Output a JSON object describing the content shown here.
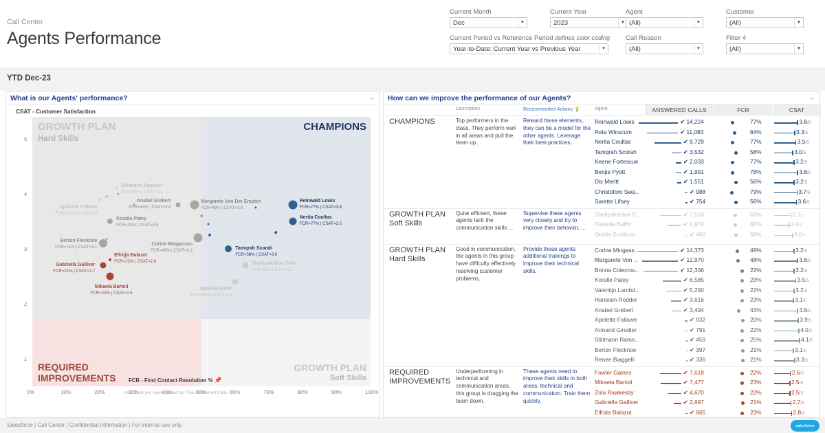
{
  "header": {
    "breadcrumb": "Call Center",
    "title": "Agents Performance"
  },
  "filters": [
    {
      "label": "Current Month",
      "value": "Dec",
      "note": ""
    },
    {
      "label": "Current Year",
      "value": "2023",
      "note": ""
    },
    {
      "label": "Agent",
      "value": "(All)",
      "note": ""
    },
    {
      "label": "Customer",
      "value": "(All)",
      "note": ""
    },
    {
      "label": "Current Period vs Reference Period",
      "value": "Year-to-Date: Current Year vs Previous Year",
      "note": "defines color coding"
    },
    {
      "label": "Call Reason",
      "value": "(All)",
      "note": ""
    },
    {
      "label": "Filter 4",
      "value": "(All)",
      "note": ""
    }
  ],
  "period_bar": {
    "label": "YTD Dec-23"
  },
  "left_panel": {
    "title": "What is our Agents' performance?",
    "arrow": "→"
  },
  "right_panel": {
    "title": "How can we improve the performance of our Agents?",
    "arrow": "→"
  },
  "footer": {
    "text": "Salesforce | Call Center | Confidential Information | For internal use only",
    "logo": "salesforce"
  },
  "chart_data": {
    "type": "scatter",
    "title": "What is our Agents' performance?",
    "xlabel": "FCR - First Contact Resolution %",
    "ylabel": "CSAT - Customer Satisfaction",
    "footnote": "One circle per Agent, sized by Total Answered Calls",
    "xlim": [
      0,
      100
    ],
    "ylim": [
      0.5,
      5.4
    ],
    "xticks": [
      "0%",
      "10%",
      "20%",
      "30%",
      "40%",
      "50%",
      "60%",
      "70%",
      "80%",
      "90%",
      "100%"
    ],
    "yticks": [
      "5",
      "4",
      "3",
      "2",
      "1"
    ],
    "grid": false,
    "quadrants": [
      {
        "key": "tl",
        "title": "GROWTH PLAN",
        "subtitle": "Hard Skills",
        "color": "#e8e8e8"
      },
      {
        "key": "tr",
        "title": "CHAMPIONS",
        "subtitle": "",
        "color": "#e1e6ec"
      },
      {
        "key": "bl",
        "title": "REQUIRED IMPROVEMENTS",
        "subtitle": "",
        "color": "#f7e2e1"
      },
      {
        "key": "br",
        "title": "GROWTH PLAN",
        "subtitle": "Soft Skills",
        "color": "#f5f4f4"
      }
    ],
    "points": [
      {
        "name": "Reinwald Lowis",
        "fcr": 77,
        "csat": 3.8,
        "label": "Reinwald Lowis",
        "sub": "FCR=77% | CSAT=3.8",
        "group": "blue",
        "size": 13
      },
      {
        "name": "Nerita Coultas",
        "fcr": 77,
        "csat": 3.5,
        "label": "Nerita Coultas",
        "sub": "FCR=77% | CSAT=3.5",
        "group": "blue",
        "size": 11
      },
      {
        "name": "Tamqrah Scorah",
        "fcr": 58,
        "csat": 3.0,
        "label": "Tamqrah Scorah",
        "sub": "FCR=58% | CSAT=3.0",
        "group": "blue",
        "size": 10
      },
      {
        "name": "Margarete Von Der Empten",
        "fcr": 48,
        "csat": 3.8,
        "label": "Margarete Von Der Empten",
        "sub": "FCR=48% | CSAT=3.8",
        "group": "gray",
        "size": 13
      },
      {
        "name": "Corine Mingasson",
        "fcr": 49,
        "csat": 3.2,
        "label": "Corine Mingasson",
        "sub": "FCR=49% | CSAT=3.2",
        "group": "gray",
        "size": 13
      },
      {
        "name": "Anabel Grebert",
        "fcr": 43,
        "csat": 3.8,
        "label": "Anabel Grebert",
        "sub": "FCR=43% | CSAT=3.8",
        "group": "gray",
        "size": 7
      },
      {
        "name": "Stillmann Ramelet",
        "fcr": 25,
        "csat": 4.1,
        "label": "Stillmann Ramelet",
        "sub": "FCR=25% | CSAT=4.1",
        "group": "lgray",
        "size": 3
      },
      {
        "name": "Aprilette Fallawe",
        "fcr": 20,
        "csat": 3.9,
        "label": "Aprilette Fallawe",
        "sub": "FCR=20% | CSAT=3.9",
        "group": "lgray",
        "size": 4
      },
      {
        "name": "Koralle Patey",
        "fcr": 23,
        "csat": 3.5,
        "label": "Koralle Patey",
        "sub": "FCR=23% | CSAT=3.5",
        "group": "gray",
        "size": 8
      },
      {
        "name": "Berton Flecknoe",
        "fcr": 21,
        "csat": 3.1,
        "label": "Berton Flecknoe",
        "sub": "FCR=21% | CSAT=3.1",
        "group": "gray",
        "size": 12
      },
      {
        "name": "Shellysheldon Soffe",
        "fcr": 63,
        "csat": 2.7,
        "label": "Shellysheldon Soffe",
        "sub": "FCR=63% | CSAT=2.7",
        "group": "lgray",
        "size": 9
      },
      {
        "name": "Danielle Baffin",
        "fcr": 60,
        "csat": 2.4,
        "label": "Danielle Baffin",
        "sub": "FCR=60% | CSAT=2.4",
        "group": "lgray",
        "size": 8
      },
      {
        "name": "Gabriella Galliver",
        "fcr": 21,
        "csat": 2.7,
        "label": "Gabriella Galliver",
        "sub": "FCR=21% | CSAT=2.7",
        "group": "red",
        "size": 9
      },
      {
        "name": "Elfrida Balazot",
        "fcr": 23,
        "csat": 2.8,
        "label": "Elfrida Balazot",
        "sub": "FCR=23% | CSAT=2.8",
        "group": "red",
        "size": 4
      },
      {
        "name": "Mikaela Bartoli",
        "fcr": 23,
        "csat": 2.5,
        "label": "Mikaela Bartoli",
        "sub": "FCR=23% | CSAT=2.5",
        "group": "red",
        "size": 11
      }
    ]
  },
  "table": {
    "columns": {
      "description": "Description",
      "recommended": "Recommended Actions",
      "recommended_icon": "lightbulb-icon",
      "agent": "Agent",
      "answered_calls": "ANSWERED CALLS",
      "fcr": "FCR",
      "csat": "CSAT"
    },
    "groups": [
      {
        "name": "CHAMPIONS",
        "description": "Top performers in the class. They perform well in all areas and pull the team up.",
        "recommendation": "Reward these elements, they can be a model for the other agents. Leverage their best-practices.",
        "rows": [
          {
            "agent": "Reinwald Lowis",
            "calls": "14,224",
            "calls_num": 14224,
            "fcr": "77%",
            "fcr_num": 77,
            "csat": "3.8",
            "csat_num": 3.8,
            "style": "blue"
          },
          {
            "agent": "Reta Winscum",
            "calls": "11,083",
            "calls_num": 11083,
            "fcr": "64%",
            "fcr_num": 64,
            "csat": "3.3",
            "csat_num": 3.3,
            "style": "blue"
          },
          {
            "agent": "Nerita Coultas",
            "calls": "9,729",
            "calls_num": 9729,
            "fcr": "77%",
            "fcr_num": 77,
            "csat": "3.5",
            "csat_num": 3.5,
            "style": "blue"
          },
          {
            "agent": "Tamqrah Scorah",
            "calls": "3,532",
            "calls_num": 3532,
            "fcr": "58%",
            "fcr_num": 58,
            "csat": "3.0",
            "csat_num": 3.0,
            "style": "blue"
          },
          {
            "agent": "Keene Fortescue",
            "calls": "2,033",
            "calls_num": 2033,
            "fcr": "77%",
            "fcr_num": 77,
            "csat": "3.2",
            "csat_num": 3.2,
            "style": "blue"
          },
          {
            "agent": "Benjie Pyott",
            "calls": "1,991",
            "calls_num": 1991,
            "fcr": "78%",
            "fcr_num": 78,
            "csat": "3.8",
            "csat_num": 3.8,
            "style": "blue"
          },
          {
            "agent": "Dix Meritt",
            "calls": "1,551",
            "calls_num": 1551,
            "fcr": "56%",
            "fcr_num": 56,
            "csat": "3.2",
            "csat_num": 3.2,
            "style": "blue"
          },
          {
            "agent": "Christoforo Swa..",
            "calls": "988",
            "calls_num": 988,
            "fcr": "79%",
            "fcr_num": 79,
            "csat": "3.7",
            "csat_num": 3.7,
            "style": "blue"
          },
          {
            "agent": "Sarette Lifsey",
            "calls": "754",
            "calls_num": 754,
            "fcr": "56%",
            "fcr_num": 56,
            "csat": "3.6",
            "csat_num": 3.6,
            "style": "blue"
          }
        ]
      },
      {
        "name": "GROWTH PLAN Soft Skills",
        "description": "Quite efficient, these agents lack the communication skills ...",
        "recommendation": "Supervise these agents very closely and try to improve their behavior, ...",
        "rows": [
          {
            "agent": "Shellysheldon S..",
            "calls": "7,518",
            "calls_num": 7518,
            "fcr": "63%",
            "fcr_num": 63,
            "csat": "2.7",
            "csat_num": 2.7,
            "style": "mute"
          },
          {
            "agent": "Danielle Baffin",
            "calls": "4,972",
            "calls_num": 4972,
            "fcr": "60%",
            "fcr_num": 60,
            "csat": "2.4",
            "csat_num": 2.4,
            "style": "mute"
          },
          {
            "agent": "Odelia Scothron",
            "calls": "460",
            "calls_num": 460,
            "fcr": "58%",
            "fcr_num": 58,
            "csat": "3.0",
            "csat_num": 3.0,
            "style": "mute"
          }
        ]
      },
      {
        "name": "GROWTH PLAN Hard Skills",
        "description": "Good in communication, the agents in this group have difficulty effectively resolving customer problems.",
        "recommendation": "Provide these agents additional trainings to improve their technical skills.",
        "rows": [
          {
            "agent": "Corine Mingass..",
            "calls": "14,373",
            "calls_num": 14373,
            "fcr": "49%",
            "fcr_num": 49,
            "csat": "3.2",
            "csat_num": 3.2,
            "style": "dgray"
          },
          {
            "agent": "Margarete Von ..",
            "calls": "12,970",
            "calls_num": 12970,
            "fcr": "48%",
            "fcr_num": 48,
            "csat": "3.8",
            "csat_num": 3.8,
            "style": "dgray"
          },
          {
            "agent": "Brinna Colecrou..",
            "calls": "12,336",
            "calls_num": 12336,
            "fcr": "22%",
            "fcr_num": 22,
            "csat": "3.2",
            "csat_num": 3.2,
            "style": "dgray"
          },
          {
            "agent": "Koralle Patey",
            "calls": "6,585",
            "calls_num": 6585,
            "fcr": "23%",
            "fcr_num": 23,
            "csat": "3.5",
            "csat_num": 3.5,
            "style": "gray"
          },
          {
            "agent": "Valentijn Lambd..",
            "calls": "5,290",
            "calls_num": 5290,
            "fcr": "22%",
            "fcr_num": 22,
            "csat": "3.2",
            "csat_num": 3.2,
            "style": "gray"
          },
          {
            "agent": "Hansiain Rodder",
            "calls": "3,616",
            "calls_num": 3616,
            "fcr": "23%",
            "fcr_num": 23,
            "csat": "3.1",
            "csat_num": 3.1,
            "style": "gray"
          },
          {
            "agent": "Anabel Grebert",
            "calls": "3,494",
            "calls_num": 3494,
            "fcr": "43%",
            "fcr_num": 43,
            "csat": "3.8",
            "csat_num": 3.8,
            "style": "gray"
          },
          {
            "agent": "Aprilette Fallawe",
            "calls": "932",
            "calls_num": 932,
            "fcr": "20%",
            "fcr_num": 20,
            "csat": "3.9",
            "csat_num": 3.9,
            "style": "gray"
          },
          {
            "agent": "Armand Girodier",
            "calls": "791",
            "calls_num": 791,
            "fcr": "22%",
            "fcr_num": 22,
            "csat": "4.0",
            "csat_num": 4.0,
            "style": "gray"
          },
          {
            "agent": "Stillmann Rame..",
            "calls": "459",
            "calls_num": 459,
            "fcr": "25%",
            "fcr_num": 25,
            "csat": "4.1",
            "csat_num": 4.1,
            "style": "gray"
          },
          {
            "agent": "Berton Flecknoe",
            "calls": "397",
            "calls_num": 397,
            "fcr": "21%",
            "fcr_num": 21,
            "csat": "3.1",
            "csat_num": 3.1,
            "style": "gray"
          },
          {
            "agent": "Renee Biaggelli",
            "calls": "336",
            "calls_num": 336,
            "fcr": "21%",
            "fcr_num": 21,
            "csat": "3.3",
            "csat_num": 3.3,
            "style": "gray"
          }
        ]
      },
      {
        "name": "REQUIRED IMPROVEMENTS",
        "description": "Underperforming in technical and communication areas, this group is dragging the team down.",
        "recommendation": "These agents need to improve their skills in both areas, technical and communication. Train them quickly.",
        "rows": [
          {
            "agent": "Fowler Gaines",
            "calls": "7,618",
            "calls_num": 7618,
            "fcr": "22%",
            "fcr_num": 22,
            "csat": "2.6",
            "csat_num": 2.6,
            "style": "red"
          },
          {
            "agent": "Mikaela Bartoli",
            "calls": "7,477",
            "calls_num": 7477,
            "fcr": "23%",
            "fcr_num": 23,
            "csat": "2.5",
            "csat_num": 2.5,
            "style": "red"
          },
          {
            "agent": "Zola Rawkesby",
            "calls": "4,670",
            "calls_num": 4670,
            "fcr": "22%",
            "fcr_num": 22,
            "csat": "2.5",
            "csat_num": 2.5,
            "style": "red"
          },
          {
            "agent": "Gabriella Galliver",
            "calls": "2,697",
            "calls_num": 2697,
            "fcr": "21%",
            "fcr_num": 21,
            "csat": "2.7",
            "csat_num": 2.7,
            "style": "red"
          },
          {
            "agent": "Elfrida Balazot",
            "calls": "665",
            "calls_num": 665,
            "fcr": "23%",
            "fcr_num": 23,
            "csat": "2.8",
            "csat_num": 2.8,
            "style": "red"
          }
        ]
      }
    ]
  }
}
